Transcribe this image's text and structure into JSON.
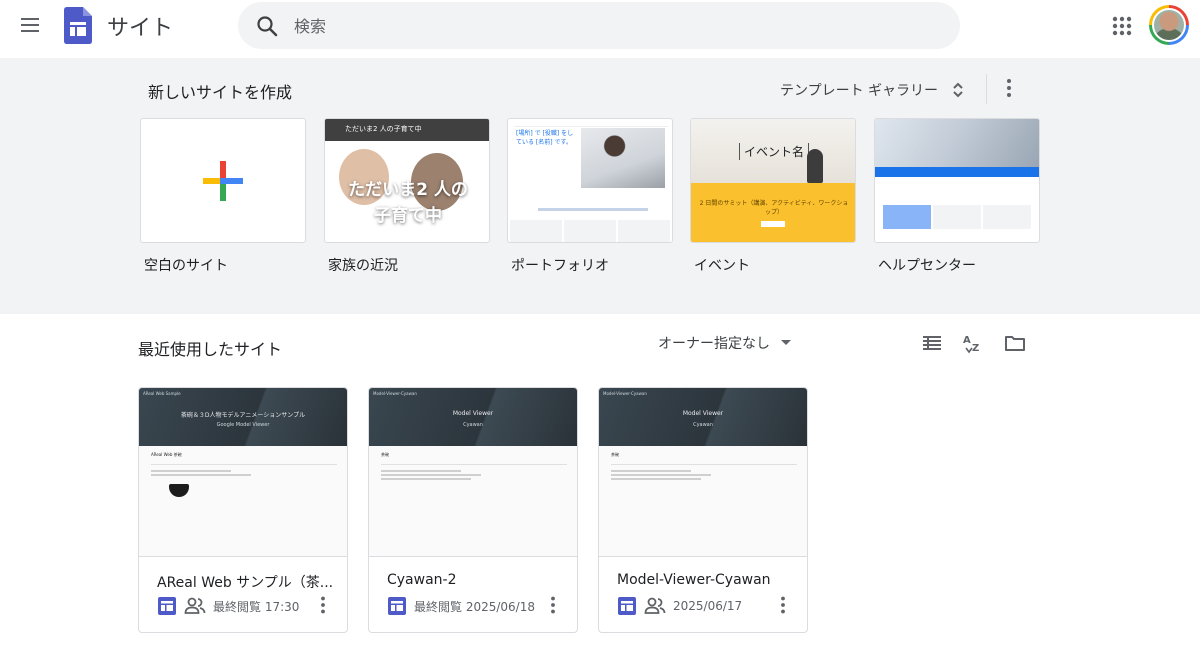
{
  "header": {
    "app_title": "サイト",
    "search_placeholder": "検索"
  },
  "gallery": {
    "title": "新しいサイトを作成",
    "toggle_label": "テンプレート ギャラリー",
    "templates": [
      {
        "label": "空白のサイト"
      },
      {
        "label": "家族の近況",
        "thumb_bar_text": "ただいま2 人の子育て中",
        "thumb_headline_1": "ただいま2 人の",
        "thumb_headline_2": "子育て中"
      },
      {
        "label": "ポートフォリオ",
        "thumb_text": "[場所] で [役職] をしている [名前] です。"
      },
      {
        "label": "イベント",
        "thumb_title": "イベント名",
        "thumb_text": "2 日間のサミット（講演、アクティビティ、ワークショップ）"
      },
      {
        "label": "ヘルプセンター"
      }
    ]
  },
  "recent": {
    "title": "最近使用したサイト",
    "owner_filter": "オーナー指定なし",
    "sites": [
      {
        "name": "AReal Web サンプル（茶...",
        "meta": "最終閲覧 17:30",
        "shared": true,
        "preview_small": "AReal Web Sample",
        "preview_title": "茶碗＆３D人物モデルアニメーションサンプル",
        "preview_sub": "Google Model Viewer",
        "preview_head": "AReal Web 茶碗"
      },
      {
        "name": "Cyawan-2",
        "meta": "最終閲覧 2025/06/18",
        "shared": false,
        "preview_small": "Model-Viewer-Cyawan",
        "preview_title": "Model Viewer",
        "preview_sub": "Cyawan",
        "preview_head": "茶碗"
      },
      {
        "name": "Model-Viewer-Cyawan",
        "meta": "2025/06/17",
        "shared": true,
        "preview_small": "Model-Viewer-Cyawan",
        "preview_title": "Model Viewer",
        "preview_sub": "Cyawan",
        "preview_head": "茶碗"
      }
    ]
  },
  "colors": {
    "sites_brand": "#4e5ac8",
    "gallery_bg": "#f1f3f4",
    "event_yellow": "#fbc02d",
    "help_blue": "#1a73e8"
  },
  "icons": [
    "menu-icon",
    "sites-logo-icon",
    "search-icon",
    "apps-grid-icon",
    "avatar",
    "expand-collapse-icon",
    "more-vert-icon",
    "plus-icon",
    "dropdown-arrow-icon",
    "list-view-icon",
    "sort-az-icon",
    "folder-icon",
    "sites-file-icon",
    "shared-people-icon"
  ]
}
